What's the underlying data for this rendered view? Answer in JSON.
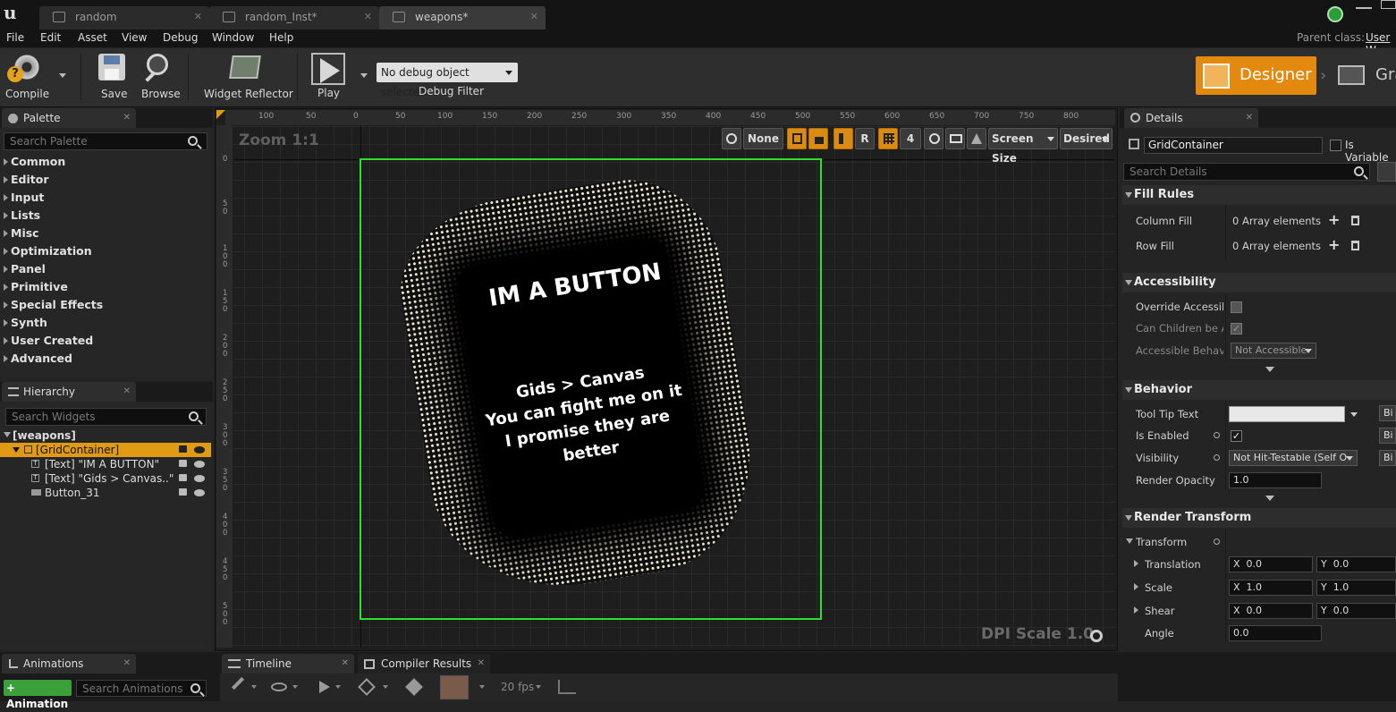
{
  "tabs": [
    {
      "label": "random"
    },
    {
      "label": "random_Inst*"
    },
    {
      "label": "weapons*"
    }
  ],
  "menu": [
    "File",
    "Edit",
    "Asset",
    "View",
    "Debug",
    "Window",
    "Help"
  ],
  "parent_class": {
    "label": "Parent class:",
    "value": "User W"
  },
  "toolbar": {
    "compile": "Compile",
    "save": "Save",
    "browse": "Browse",
    "widget_reflector": "Widget Reflector",
    "play": "Play",
    "debug_object": "No debug object selected",
    "debug_filter": "Debug Filter",
    "designer": "Designer",
    "graph": "Gra"
  },
  "palette": {
    "title": "Palette",
    "search_placeholder": "Search Palette",
    "categories": [
      "Common",
      "Editor",
      "Input",
      "Lists",
      "Misc",
      "Optimization",
      "Panel",
      "Primitive",
      "Special Effects",
      "Synth",
      "User Created",
      "Advanced"
    ]
  },
  "hierarchy": {
    "title": "Hierarchy",
    "search_placeholder": "Search Widgets",
    "root": "[weapons]",
    "items": [
      {
        "label": "[GridContainer]"
      },
      {
        "label": "[Text] \"IM A BUTTON\""
      },
      {
        "label": "[Text] \"Gids > Canvas..\""
      },
      {
        "label": "Button_31"
      }
    ]
  },
  "ruler": {
    "h": [
      "100",
      "50",
      "0",
      "50",
      "100",
      "150",
      "200",
      "250",
      "300",
      "350",
      "400",
      "450",
      "500",
      "550",
      "600",
      "650",
      "700",
      "750",
      "800"
    ],
    "v": [
      "0",
      "5\n0",
      "1\n0\n0",
      "1\n5\n0",
      "2\n0\n0",
      "2\n5\n0",
      "3\n0\n0",
      "3\n5\n0",
      "4\n0\n0",
      "4\n5\n0",
      "5\n0\n0"
    ]
  },
  "canvas": {
    "zoom": "Zoom 1:1",
    "dpi": "DPI Scale 1.0",
    "none": "None",
    "r": "R",
    "grid_num": "4",
    "screen_size": "Screen Size",
    "desired": "Desired",
    "button_text": "IM A BUTTON",
    "body_lines": [
      "Gids > Canvas",
      "You can fight me on it",
      "I promise they are",
      "better"
    ]
  },
  "details": {
    "title": "Details",
    "name": "GridContainer",
    "is_variable": "Is Variable",
    "search_placeholder": "Search Details",
    "fill_rules": {
      "title": "Fill Rules",
      "column_fill": "Column Fill",
      "row_fill": "Row Fill",
      "array_value": "0 Array elements"
    },
    "accessibility": {
      "title": "Accessibility",
      "override": "Override Accessible",
      "children": "Can Children be Acc",
      "behavior": "Accessible Behavio",
      "behavior_value": "Not Accessible"
    },
    "behavior": {
      "title": "Behavior",
      "tooltip": "Tool Tip Text",
      "enabled": "Is Enabled",
      "visibility": "Visibility",
      "visibility_value": "Not Hit-Testable (Self O",
      "opacity": "Render Opacity",
      "opacity_value": "1.0",
      "bind": "Bi"
    },
    "render_transform": {
      "title": "Render Transform",
      "transform": "Transform",
      "translation": "Translation",
      "scale": "Scale",
      "shear": "Shear",
      "angle": "Angle",
      "t_x": "0.0",
      "t_y": "0.0",
      "s_x": "1.0",
      "s_y": "1.0",
      "sh_x": "0.0",
      "sh_y": "0.0",
      "angle_value": "0.0"
    }
  },
  "bottom": {
    "animations": "Animations",
    "add_animation": "+ Animation",
    "search_animations": "Search Animations",
    "timeline": "Timeline",
    "compiler_results": "Compiler Results",
    "fps": "20 fps"
  }
}
